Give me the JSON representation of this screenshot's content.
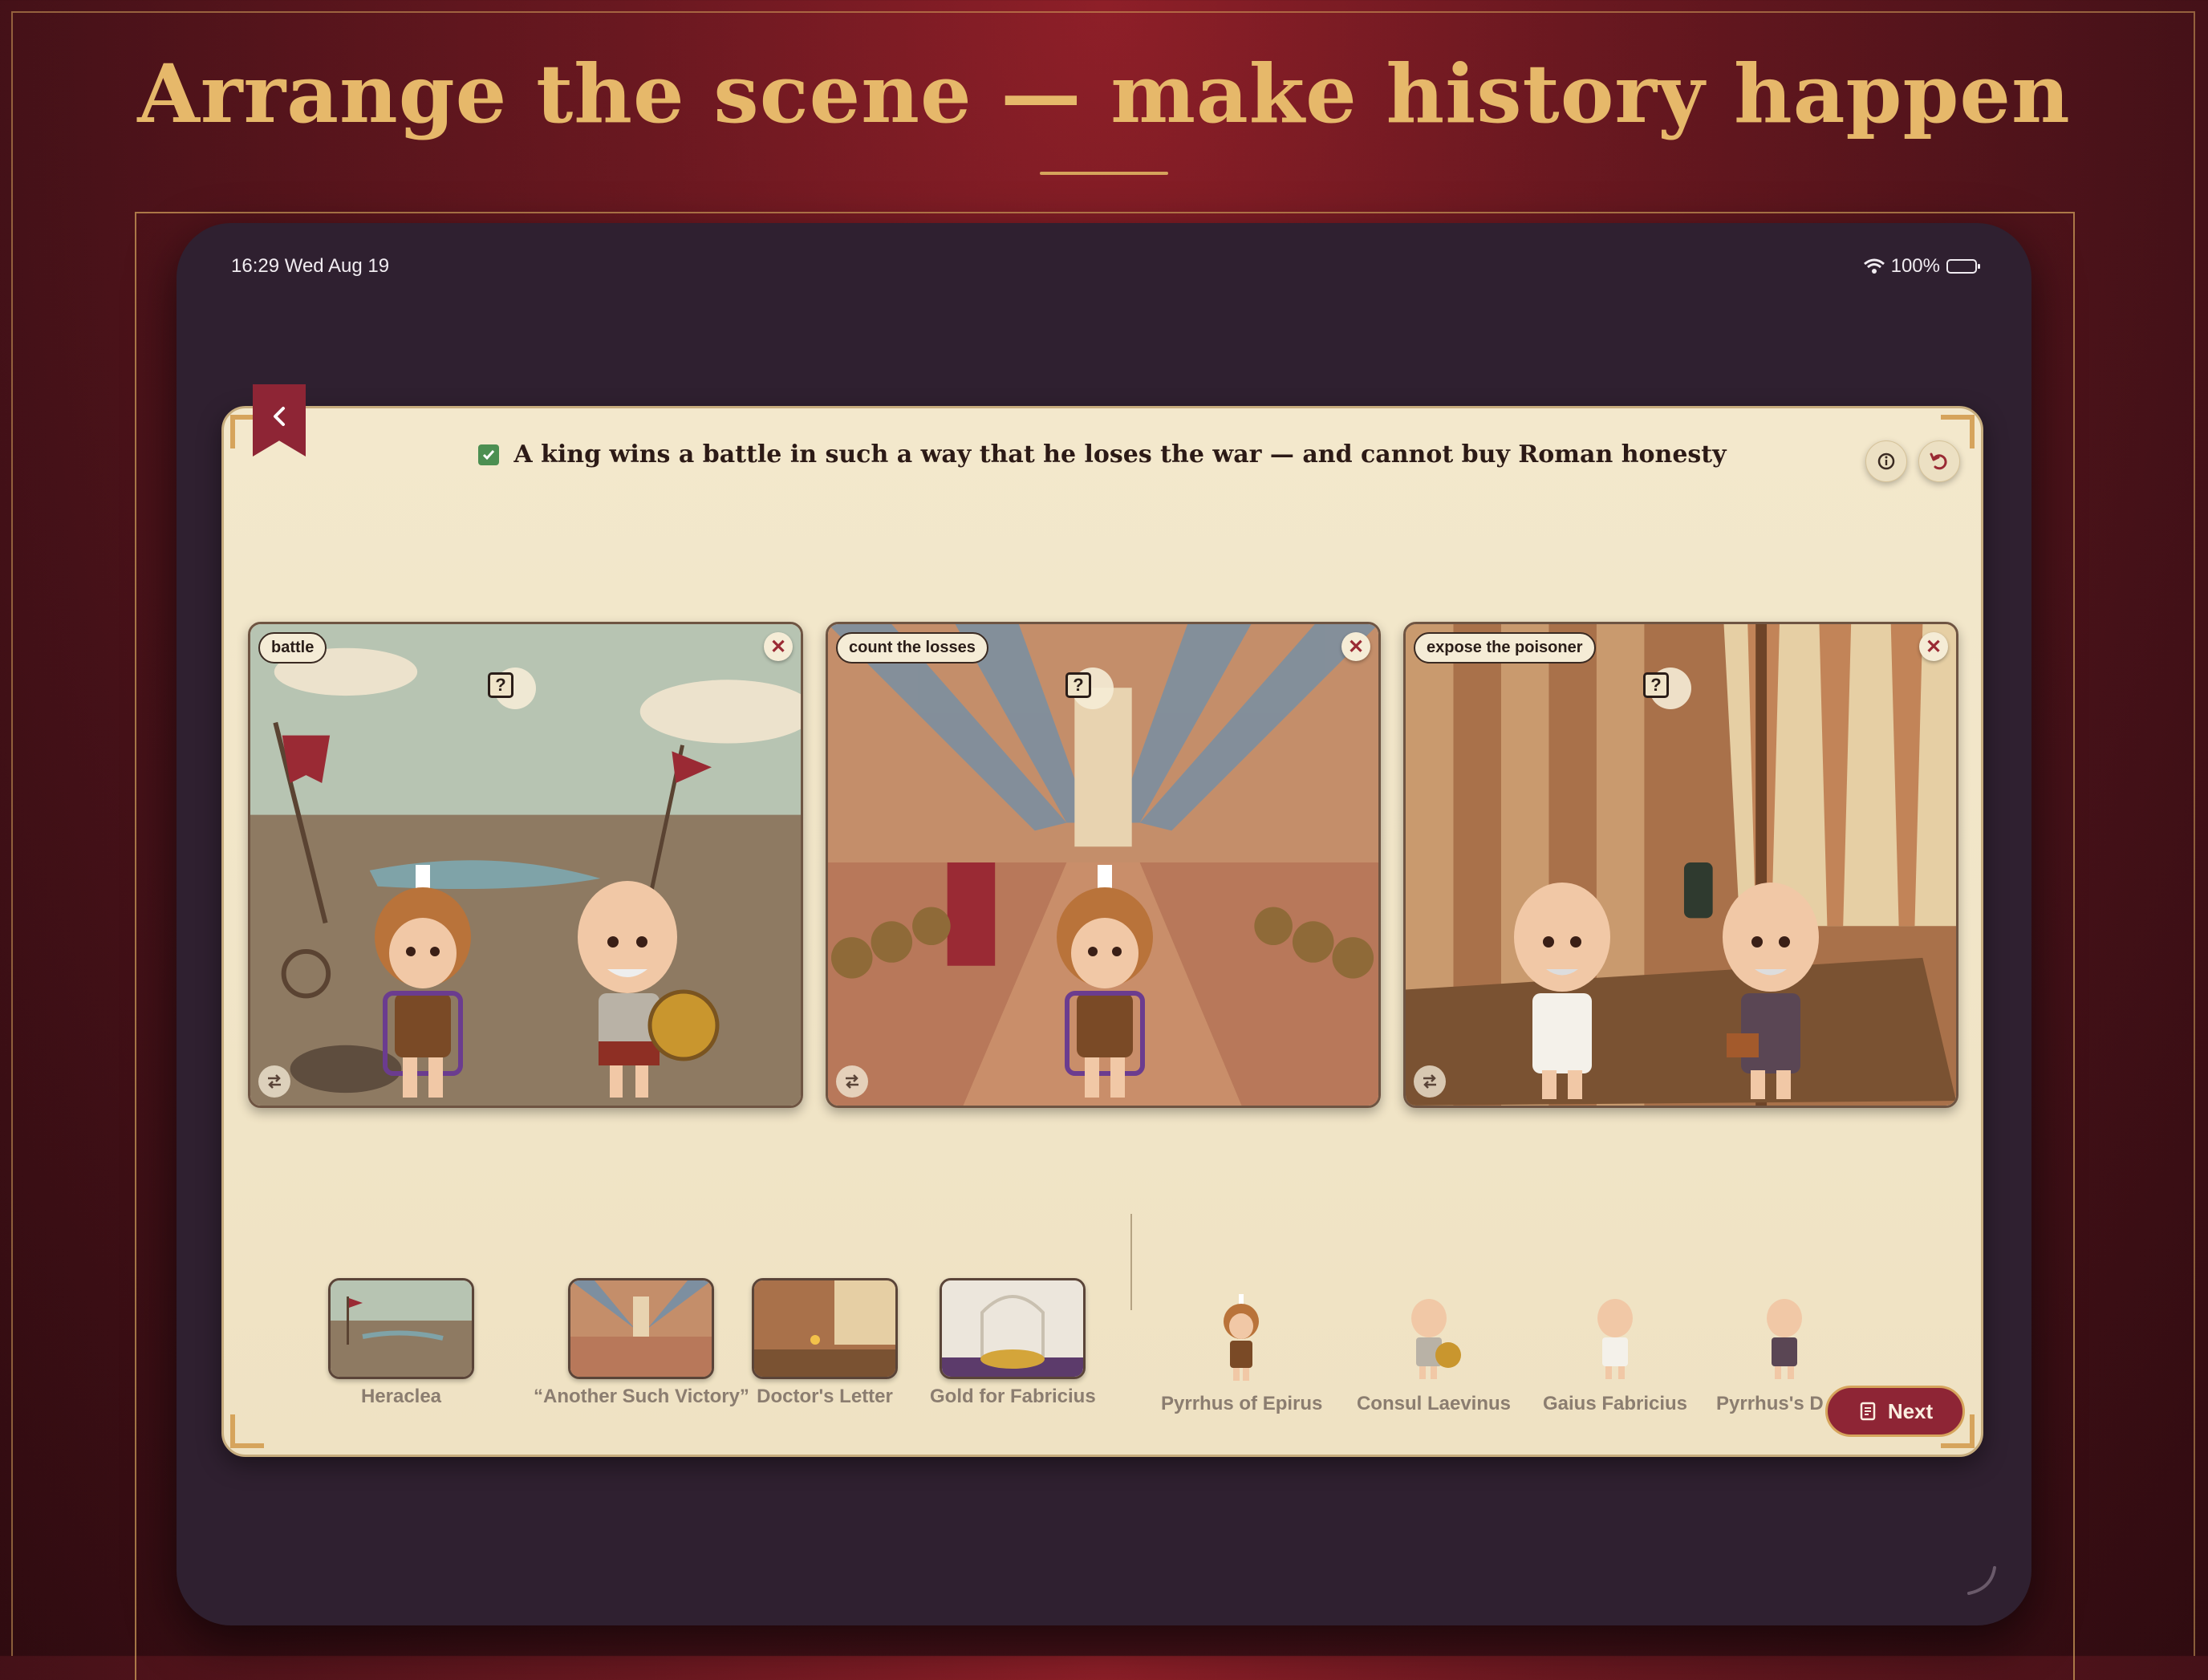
{
  "headline": "Arrange the scene — make history happen",
  "status": {
    "time": "16:29  Wed Aug 19",
    "battery": "100%"
  },
  "goal": {
    "text": "A king wins a battle in such a way that he loses the war — and cannot buy Roman honesty",
    "completed": true
  },
  "scenes": [
    {
      "tag": "battle",
      "setting": "Heraclea",
      "characters": [
        "Pyrrhus of Epirus",
        "Consul Laevinus"
      ]
    },
    {
      "tag": "count the losses",
      "setting": "“Another Such Victory”",
      "characters": [
        "Pyrrhus of Epirus"
      ]
    },
    {
      "tag": "expose the poisoner",
      "setting": "Doctor's Letter",
      "characters": [
        "Gaius Fabricius",
        "Pyrrhus's Doctor"
      ]
    }
  ],
  "tray": {
    "settings": [
      "Heraclea",
      "“Another Such Victory”",
      "Doctor's Letter",
      "Gold for Fabricius"
    ],
    "characters": [
      "Pyrrhus of Epirus",
      "Consul Laevinus",
      "Gaius Fabricius",
      "Pyrrhus's D"
    ]
  },
  "scene_q": "?",
  "next_label": "Next",
  "colors": {
    "accent": "#8e2535",
    "gold": "#d6a45c",
    "parchment": "#f3e8cc",
    "device": "#2f2030"
  }
}
